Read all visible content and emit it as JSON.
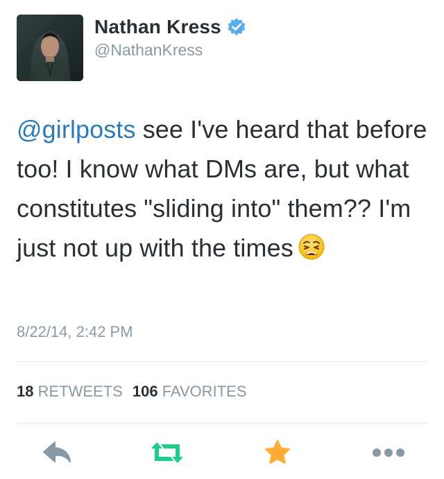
{
  "user": {
    "display_name": "Nathan Kress",
    "handle": "@NathanKress",
    "verified": true,
    "avatar_icon": "profile-photo"
  },
  "tweet": {
    "mention": "@girlposts",
    "text": " see I've heard that before too! I know what DMs are, but what constitutes \"sliding into\" them?? I'm just not up with the times",
    "emoji": "weary-face-emoji",
    "timestamp": "8/22/14, 2:42 PM"
  },
  "stats": {
    "retweets_count": "18",
    "retweets_label": "RETWEETS",
    "favorites_count": "106",
    "favorites_label": "FAVORITES"
  },
  "actions": {
    "reply_icon": "reply-icon",
    "retweet_icon": "retweet-icon",
    "favorite_icon": "star-icon",
    "more_icon": "more-icon"
  },
  "colors": {
    "mention": "#2b7bb9",
    "verified": "#55acee",
    "retweet_green": "#19cf86",
    "favorite_gold": "#ffac33",
    "muted_gray": "#8899a6",
    "text_dark": "#292f33"
  }
}
